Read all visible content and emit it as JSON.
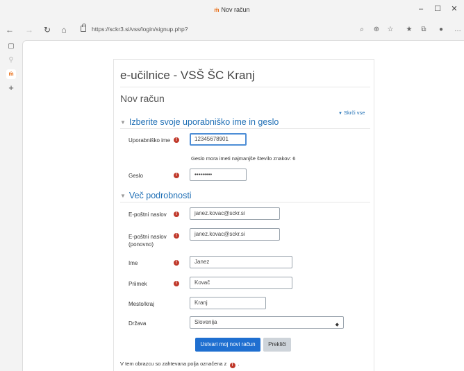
{
  "window": {
    "title": "Nov račun",
    "favicon_text": "ṁ",
    "minimize": "–",
    "maximize": "☐",
    "close": "✕"
  },
  "navbar": {
    "url": "https://sckr3.si/vss/login/signup.php?",
    "more": "…"
  },
  "page": {
    "site_title": "e-učilnice - VSŠ ŠC Kranj",
    "heading": "Nov račun",
    "collapse_all": "Skrči vse"
  },
  "sections": {
    "login": {
      "title": "Izberite svoje uporabniško ime in geslo",
      "username_label": "Uporabniško ime",
      "username_value": "12345678901",
      "password_hint": "Geslo mora imeti najmanjše število znakov: 6",
      "password_label": "Geslo",
      "password_value": "•••••••••"
    },
    "details": {
      "title": "Več podrobnosti",
      "email_label": "E-poštni naslov",
      "email_value": "janez.kovac@sckr.si",
      "email2_label_1": "E-poštni naslov",
      "email2_label_2": "(ponovno)",
      "email2_value": "janez.kovac@sckr.si",
      "firstname_label": "Ime",
      "firstname_value": "Janez",
      "lastname_label": "Priimek",
      "lastname_value": "Kovač",
      "city_label": "Mesto/kraj",
      "city_value": "Kranj",
      "country_label": "Država",
      "country_value": "Slovenija"
    }
  },
  "buttons": {
    "submit": "Ustvari moj novi račun",
    "cancel": "Prekliči"
  },
  "footer": {
    "note_before": "V tem obrazcu so zahtevana polja označena z",
    "note_after": "."
  },
  "colors": {
    "accent": "#1f6fb5",
    "primary_button": "#1f6fd0",
    "required": "#c0392b"
  }
}
